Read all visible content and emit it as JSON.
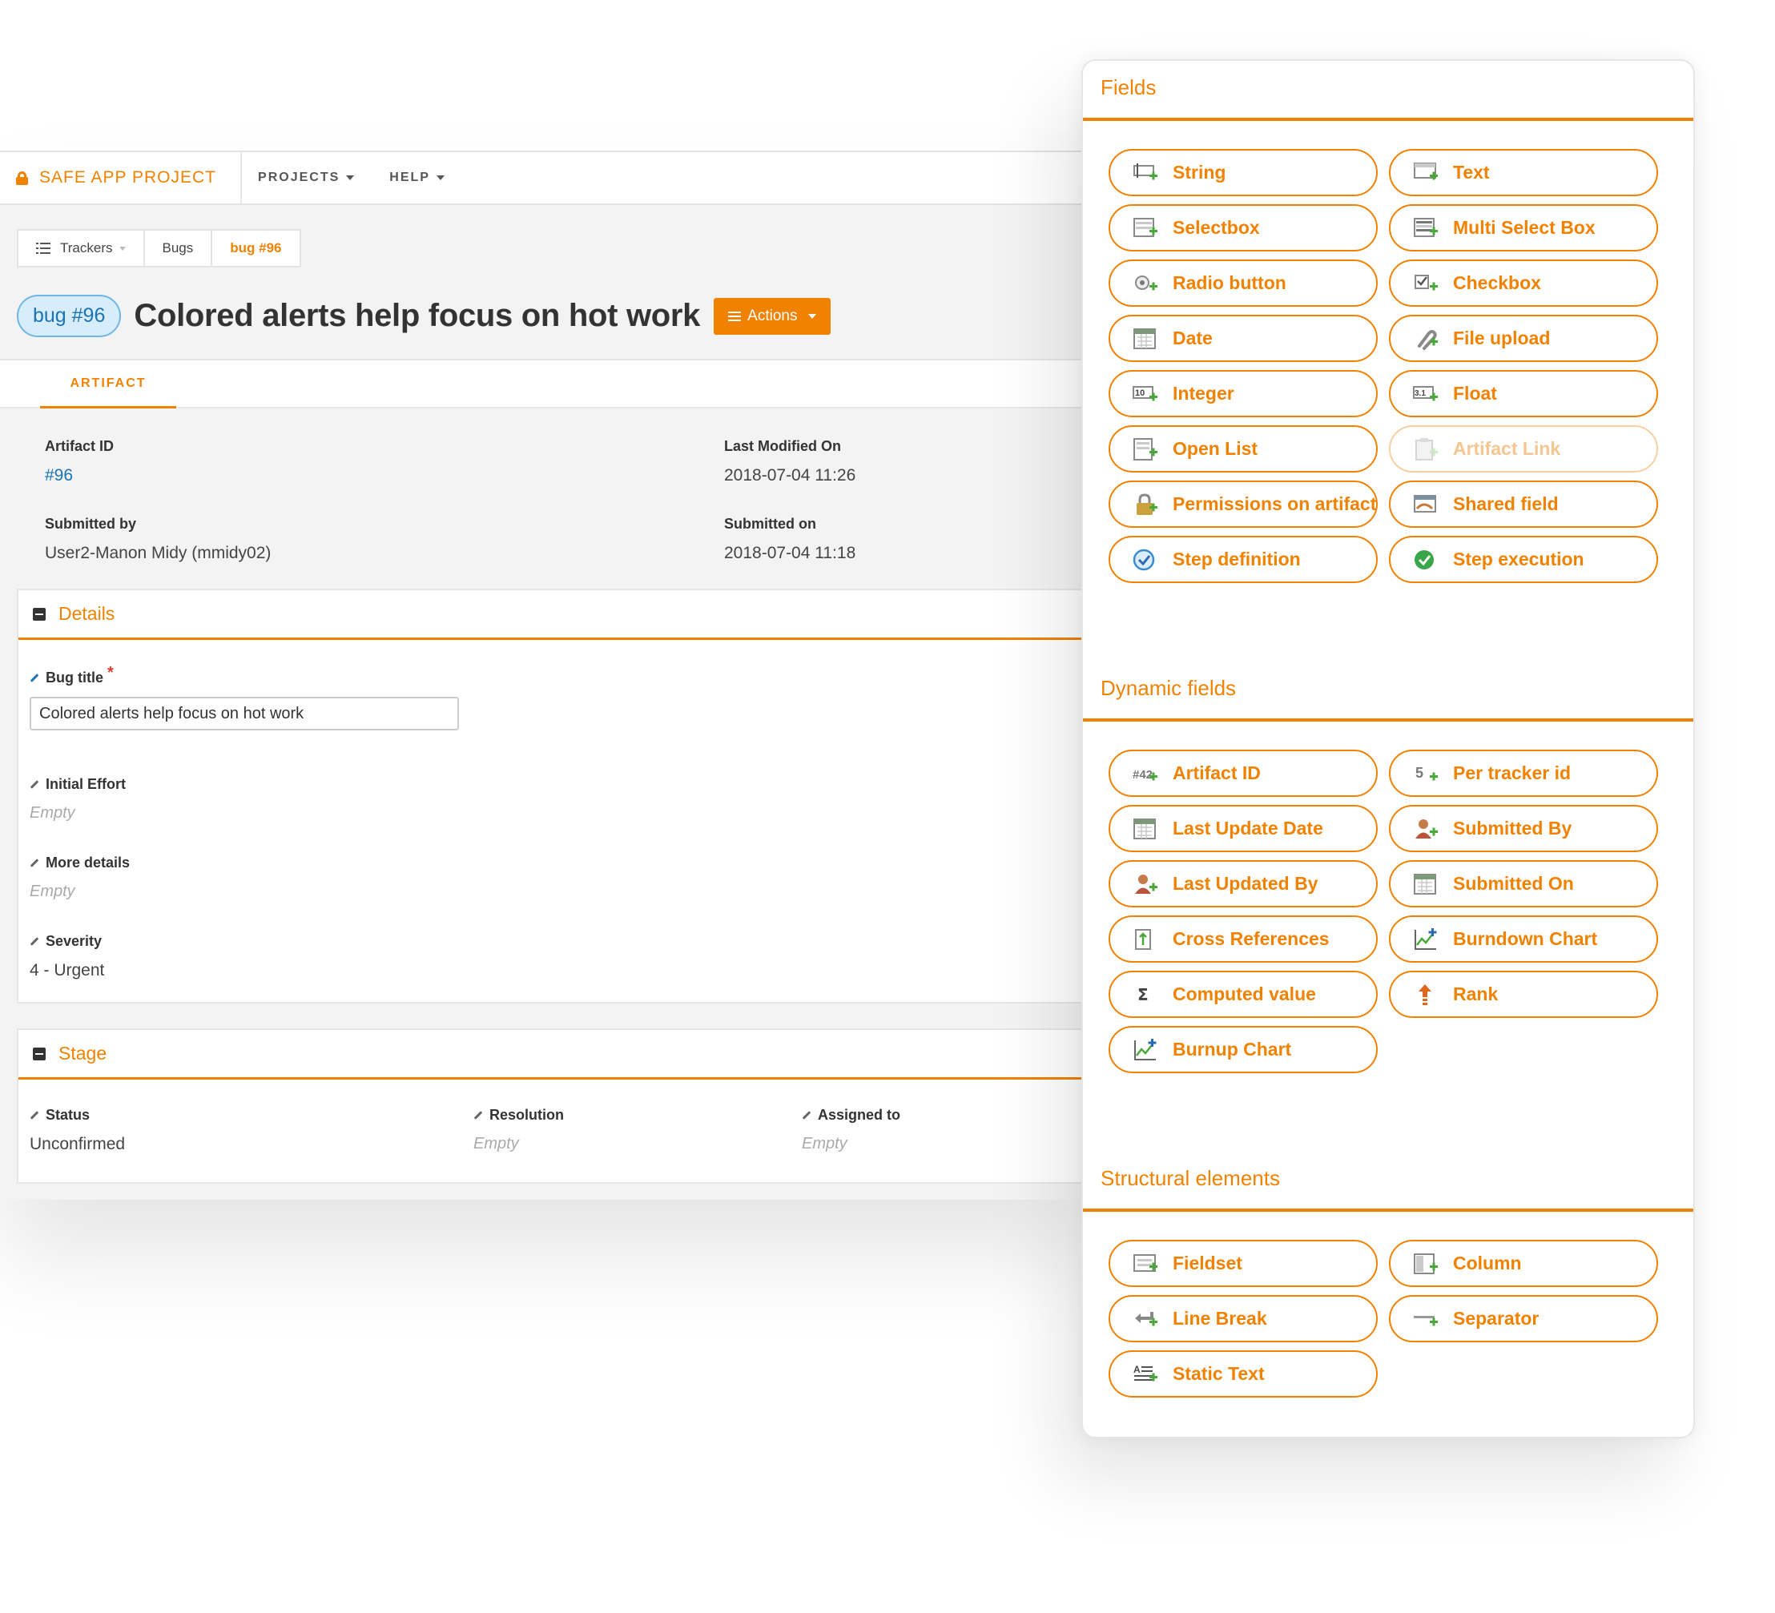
{
  "nav": {
    "project_name": "SAFE APP PROJECT",
    "menu": [
      "PROJECTS",
      "HELP"
    ]
  },
  "breadcrumb": {
    "trackers": "Trackers",
    "bugs": "Bugs",
    "current": "bug #96"
  },
  "artifact": {
    "badge": "bug #96",
    "title": "Colored alerts help focus on hot work",
    "actions_label": "Actions",
    "tab": "ARTIFACT"
  },
  "meta": {
    "artifact_id_label": "Artifact ID",
    "artifact_id_value": "#96",
    "last_modified_label": "Last Modified On",
    "last_modified_value": "2018-07-04 11:26",
    "submitted_by_label": "Submitted by",
    "submitted_by_value": "User2-Manon Midy (mmidy02)",
    "submitted_on_label": "Submitted on",
    "submitted_on_value": "2018-07-04 11:18"
  },
  "details": {
    "title": "Details",
    "bug_title_label": "Bug title",
    "required_mark": "*",
    "bug_title_value": "Colored alerts help focus on hot work",
    "initial_effort_label": "Initial Effort",
    "initial_effort_value": "Empty",
    "more_details_label": "More details",
    "more_details_value": "Empty",
    "severity_label": "Severity",
    "severity_value": "4 - Urgent"
  },
  "stage": {
    "title": "Stage",
    "status_label": "Status",
    "status_value": "Unconfirmed",
    "resolution_label": "Resolution",
    "resolution_value": "Empty",
    "assigned_label": "Assigned to",
    "assigned_value": "Empty"
  },
  "palette": {
    "accent_color": "#f18200",
    "sections": [
      {
        "title": "Fields",
        "items": [
          {
            "label": "String",
            "icon": "string-field-icon"
          },
          {
            "label": "Text",
            "icon": "text-field-icon"
          },
          {
            "label": "Selectbox",
            "icon": "selectbox-icon"
          },
          {
            "label": "Multi Select Box",
            "icon": "multi-select-icon"
          },
          {
            "label": "Radio button",
            "icon": "radio-icon"
          },
          {
            "label": "Checkbox",
            "icon": "checkbox-icon"
          },
          {
            "label": "Date",
            "icon": "calendar-icon"
          },
          {
            "label": "File upload",
            "icon": "paperclip-icon"
          },
          {
            "label": "Integer",
            "icon": "integer-icon"
          },
          {
            "label": "Float",
            "icon": "float-icon"
          },
          {
            "label": "Open List",
            "icon": "open-list-icon"
          },
          {
            "label": "Artifact Link",
            "icon": "artifact-link-icon",
            "disabled": true
          },
          {
            "label": "Permissions on artifact",
            "icon": "lock-icon"
          },
          {
            "label": "Shared field",
            "icon": "shared-field-icon"
          },
          {
            "label": "Step definition",
            "icon": "step-definition-icon"
          },
          {
            "label": "Step execution",
            "icon": "step-execution-icon"
          }
        ]
      },
      {
        "title": "Dynamic fields",
        "items": [
          {
            "label": "Artifact ID",
            "icon": "hash-icon"
          },
          {
            "label": "Per tracker id",
            "icon": "per-tracker-id-icon"
          },
          {
            "label": "Last Update Date",
            "icon": "calendar-icon"
          },
          {
            "label": "Submitted By",
            "icon": "user-icon"
          },
          {
            "label": "Last Updated By",
            "icon": "user-icon"
          },
          {
            "label": "Submitted On",
            "icon": "calendar-icon"
          },
          {
            "label": "Cross References",
            "icon": "cross-reference-icon"
          },
          {
            "label": "Burndown Chart",
            "icon": "chart-icon"
          },
          {
            "label": "Computed value",
            "icon": "sigma-icon"
          },
          {
            "label": "Rank",
            "icon": "rank-icon"
          },
          {
            "label": "Burnup Chart",
            "icon": "chart-icon"
          }
        ]
      },
      {
        "title": "Structural elements",
        "items": [
          {
            "label": "Fieldset",
            "icon": "fieldset-icon"
          },
          {
            "label": "Column",
            "icon": "column-icon"
          },
          {
            "label": "Line Break",
            "icon": "line-break-icon"
          },
          {
            "label": "Separator",
            "icon": "separator-icon"
          },
          {
            "label": "Static Text",
            "icon": "static-text-icon"
          }
        ]
      }
    ]
  }
}
